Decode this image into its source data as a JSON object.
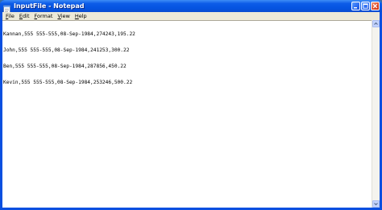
{
  "window": {
    "title": "InputFile - Notepad"
  },
  "menubar": {
    "items": [
      {
        "accel": "F",
        "rest": "ile"
      },
      {
        "accel": "E",
        "rest": "dit"
      },
      {
        "accel": "F",
        "rest": "ormat"
      },
      {
        "accel": "V",
        "rest": "iew"
      },
      {
        "accel": "H",
        "rest": "elp"
      }
    ]
  },
  "editor": {
    "lines": [
      "Kannan,555 555-555,08-Sep-1984,274243,195.22",
      "John,555 555-555,08-Sep-1984,241253,300.22",
      "Ben,555 555-555,08-Sep-1984,287856,450.22",
      "Kevin,555 555-555,08-Sep-1984,253246,500.22"
    ]
  },
  "icons": {
    "app": "notepad-icon",
    "minimize": "minimize-icon",
    "maximize": "maximize-icon",
    "close": "close-icon"
  },
  "colors": {
    "titlebar": "#0553e0",
    "close_button": "#e05030",
    "menubar": "#ece9d8",
    "editor_bg": "#ffffff"
  }
}
